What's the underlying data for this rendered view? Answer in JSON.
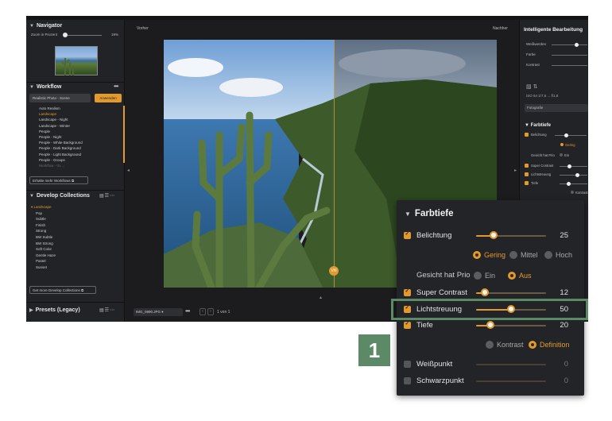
{
  "left": {
    "navigator": {
      "title": "Navigator",
      "zoom_label": "Zoom in Prozent",
      "zoom_value": "19%",
      "zoom_level": 0.19
    },
    "workflow": {
      "title": "Workflow",
      "preset_select": "Realistic Photo - Scene",
      "apply_label": "Anwenden",
      "items": [
        "Auto Realism",
        "Landscape",
        "Landscape - Night",
        "Landscape - Winter",
        "People",
        "People - Night",
        "People - White Background",
        "People - Dark Background",
        "People - Light Background",
        "People - Groups",
        "Workflow - 01 ..."
      ],
      "active_index": 1,
      "more_link": "Erhalte mehr Workflows"
    },
    "collections": {
      "title": "Develop Collections",
      "items": [
        "Landscape",
        "Pop",
        "Subtle",
        "Finish",
        "Strong",
        "BW Subtle",
        "BW Strong",
        "Soft Color",
        "Gentle Haze",
        "Pastel",
        "Sunset"
      ],
      "active_index": 0,
      "more_link": "Get more Develop Collections"
    },
    "presets": {
      "title": "Presets (Legacy)"
    }
  },
  "center": {
    "before_label": "Vorher",
    "after_label": "Nachher",
    "split_label": "VN",
    "filename": "IMG_0890.JPG",
    "page_text": "1 von 1"
  },
  "right": {
    "title": "Intelligente Bearbeitung",
    "rows": [
      "Weißwerden",
      "Farbe",
      "Kontrast"
    ],
    "info": "ISO 64   1/7,6   ...   f/1,8",
    "select": "Fotografie",
    "section": "Farbtiefe",
    "small": {
      "belichtung": "Belichtung",
      "gering": "Gering",
      "gesicht": "Gesicht hat Prio",
      "ein": "Ein",
      "super": "Super Contrast",
      "licht": "Lichtstreuung",
      "tiefe": "Tiefe",
      "kontrast": "Kontrast"
    }
  },
  "zoom": {
    "title": "Farbtiefe",
    "belichtung": {
      "label": "Belichtung",
      "value": "25",
      "level": 0.25
    },
    "options1": {
      "gering": "Gering",
      "mittel": "Mittel",
      "hoch": "Hoch"
    },
    "gesicht": {
      "label": "Gesicht hat Prio",
      "ein": "Ein",
      "aus": "Aus"
    },
    "super_contrast": {
      "label": "Super Contrast",
      "value": "12",
      "level": 0.12
    },
    "lichtstreuung": {
      "label": "Lichtstreuung",
      "value": "50",
      "level": 0.5
    },
    "tiefe": {
      "label": "Tiefe",
      "value": "20",
      "level": 0.2
    },
    "options2": {
      "kontrast": "Kontrast",
      "definition": "Definition"
    },
    "weisspunkt": {
      "label": "Weißpunkt",
      "value": "0"
    },
    "schwarzpunkt": {
      "label": "Schwarzpunkt",
      "value": "0"
    }
  },
  "marker": {
    "number": "1"
  },
  "colors": {
    "accent": "#e29a2f",
    "highlight": "#5c8a66",
    "panel": "#232427"
  }
}
